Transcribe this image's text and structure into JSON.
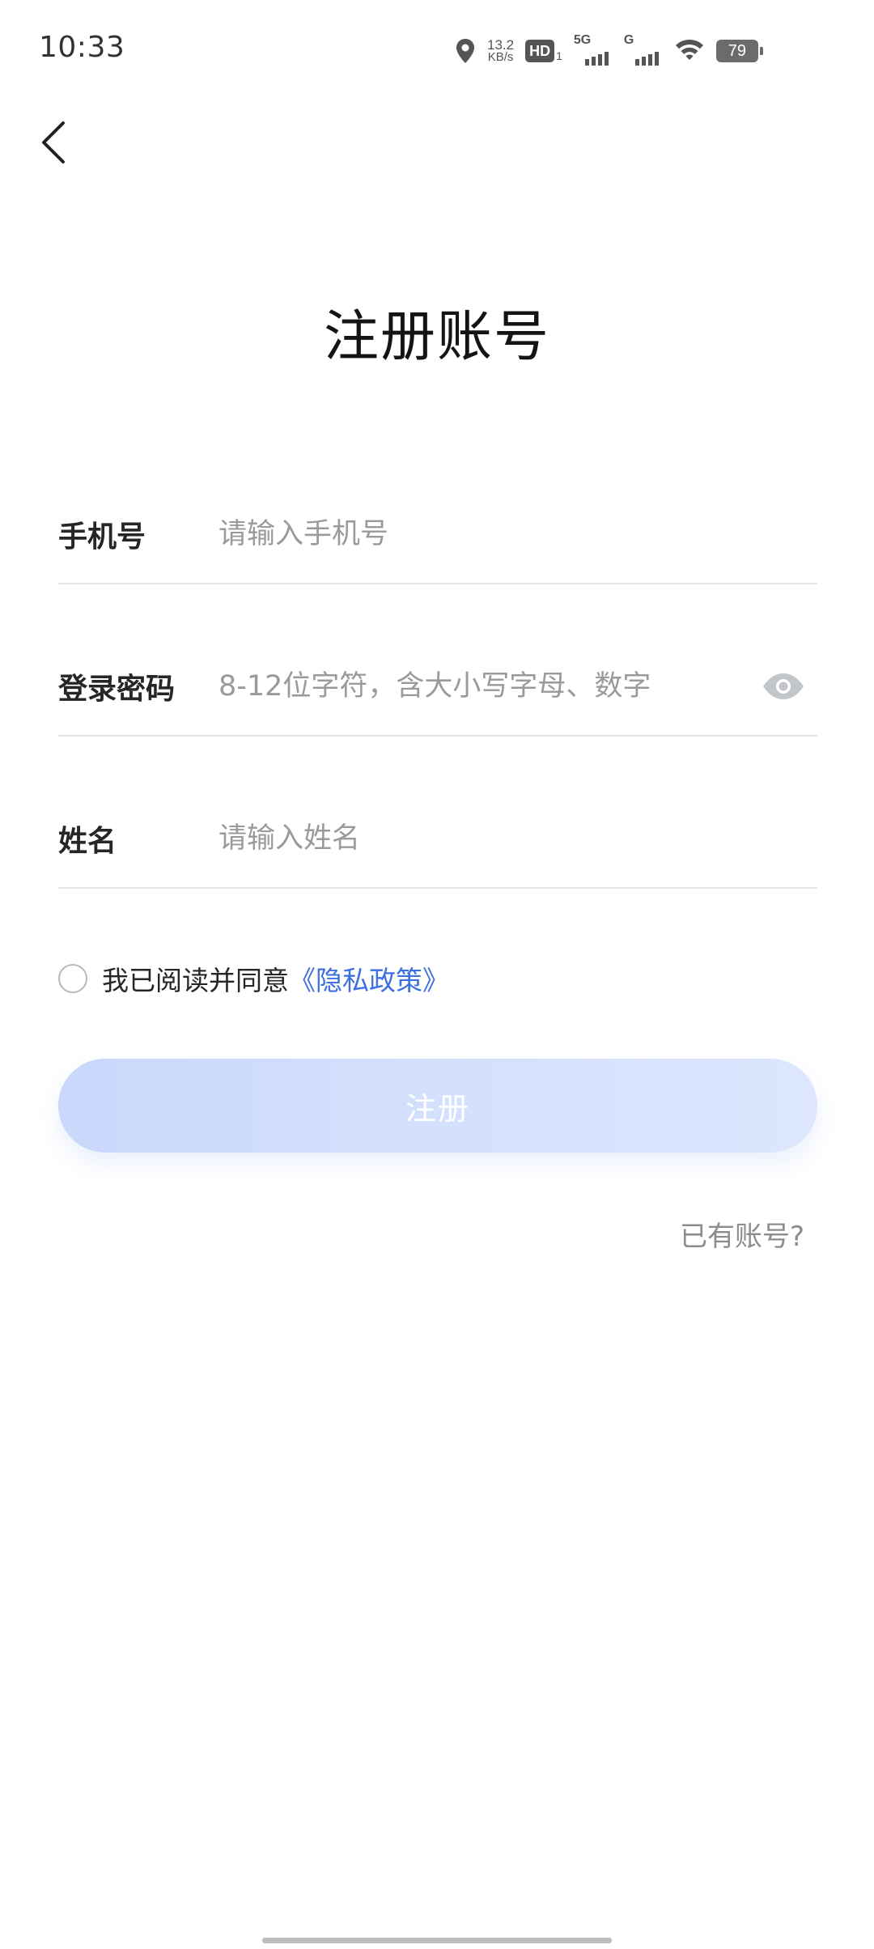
{
  "status_bar": {
    "time": "10:33",
    "net_speed_value": "13.2",
    "net_speed_unit": "KB/s",
    "hd_label": "HD",
    "hd_sub": "1",
    "signal1_tech": "5G",
    "signal2_tech": "G",
    "battery": "79",
    "icons": [
      "location-icon",
      "hd-icon",
      "signal-icon",
      "wifi-icon",
      "battery-icon"
    ]
  },
  "header": {
    "back_icon": "chevron-left-icon",
    "title": "注册账号"
  },
  "form": {
    "phone": {
      "label": "手机号",
      "placeholder": "请输入手机号",
      "value": ""
    },
    "password": {
      "label": "登录密码",
      "placeholder": "8-12位字符，含大小写字母、数字",
      "value": "",
      "toggle_icon": "eye-icon"
    },
    "name": {
      "label": "姓名",
      "placeholder": "请输入姓名",
      "value": ""
    }
  },
  "agreement": {
    "checked": false,
    "text": "我已阅读并同意",
    "link": "《隐私政策》"
  },
  "register_button": {
    "label": "注册"
  },
  "login_link": {
    "label": "已有账号?"
  },
  "colors": {
    "link": "#3d6fe0",
    "button_bg": "#d3defd",
    "placeholder": "#9a9a9a",
    "divider": "#e6e6e6"
  }
}
